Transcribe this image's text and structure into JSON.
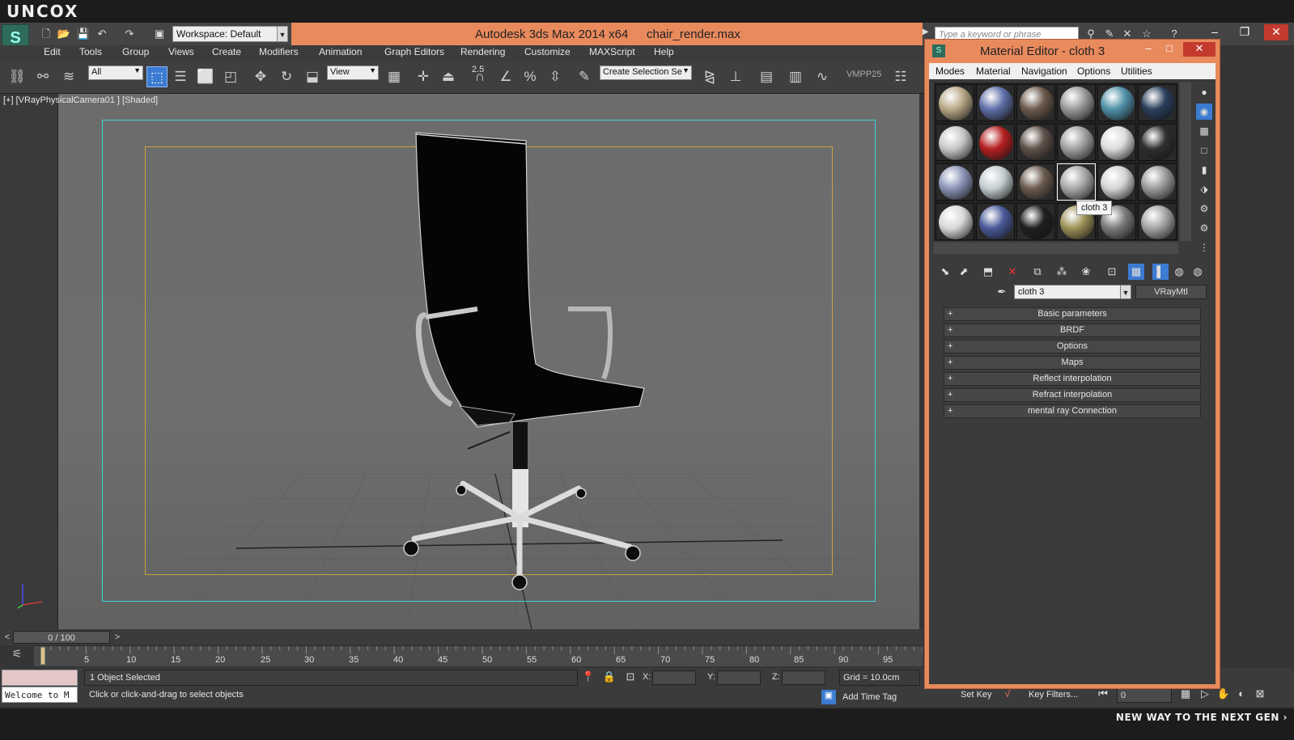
{
  "brand": "UNCOX",
  "footer_text": "NEW WAY TO THE NEXT GEN ›",
  "window": {
    "app_title": "Autodesk 3ds Max  2014 x64",
    "file_title": "chair_render.max",
    "workspace": "Workspace: Default",
    "search_placeholder": "Type a keyword or phrase"
  },
  "menus": [
    "Edit",
    "Tools",
    "Group",
    "Views",
    "Create",
    "Modifiers",
    "Animation",
    "Graph Editors",
    "Rendering",
    "Customize",
    "MAXScript",
    "Help"
  ],
  "toolbar": {
    "selection_filter": "All",
    "ref_coord": "View",
    "snap_value": "2.5",
    "named_selection": "Create Selection Se",
    "vmpp": "VMPP25"
  },
  "viewport": {
    "label": "[+] [VRayPhysicalCamera01 ] [Shaded]"
  },
  "timeline": {
    "slider": "0 / 100",
    "prev": "<",
    "next": ">",
    "ticks": [
      "5",
      "10",
      "15",
      "20",
      "25",
      "30",
      "35",
      "40",
      "45",
      "50",
      "55",
      "60",
      "65",
      "70",
      "75",
      "80",
      "85",
      "90",
      "95"
    ]
  },
  "status": {
    "maxscript": "Welcome to M",
    "selection": "1 Object Selected",
    "prompt": "Click or click-and-drag to select objects",
    "x_label": "X:",
    "y_label": "Y:",
    "z_label": "Z:",
    "grid": "Grid = 10.0cm",
    "add_time_tag": "Add Time Tag",
    "set_key": "Set Key",
    "key_filters": "Key Filters...",
    "frame": "0"
  },
  "material_editor": {
    "title": "Material Editor - cloth 3",
    "menus": [
      "Modes",
      "Material",
      "Navigation",
      "Options",
      "Utilities"
    ],
    "tooltip": "cloth 3",
    "material_name": "cloth 3",
    "material_type": "VRayMtl",
    "rollouts": [
      "Basic parameters",
      "BRDF",
      "Options",
      "Maps",
      "Reflect interpolation",
      "Refract interpolation",
      "mental ray Connection"
    ],
    "slot_colors": [
      [
        "#b8a886",
        "#5f6fa8",
        "#6b5a4c",
        "#9a9a9a",
        "#4f90a8",
        "#2b3e5c"
      ],
      [
        "#c8c8c8",
        "#b51f1f",
        "#5e5048",
        "#a0a0a0",
        "#dcdcdc",
        "#2f2f2f"
      ],
      [
        "#8a95b8",
        "#c4cdd0",
        "#6a5a4e",
        "#a8a8a8",
        "#d4d4d4",
        "#9a9a9a"
      ],
      [
        "#d8d8d8",
        "#4a5a9a",
        "#202020",
        "#9c9158",
        "#7a7a7a",
        "#a4a4a4"
      ]
    ]
  }
}
